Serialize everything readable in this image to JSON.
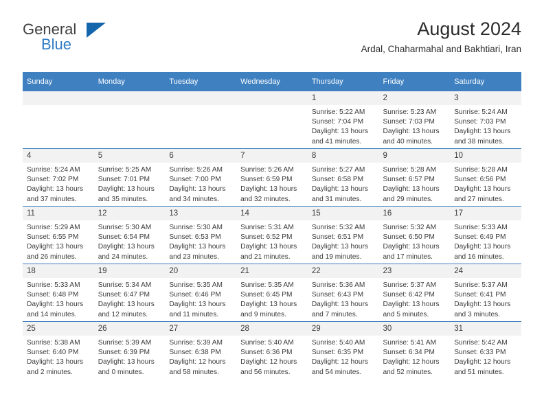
{
  "brand": {
    "name_top": "General",
    "name_bottom": "Blue",
    "logo_color": "#1466ac",
    "blue_text_color": "#2e7bc4"
  },
  "header": {
    "title": "August 2024",
    "subtitle": "Ardal, Chaharmahal and Bakhtiari, Iran",
    "accent_color": "#3f80c1"
  },
  "weekday_headers": [
    "Sunday",
    "Monday",
    "Tuesday",
    "Wednesday",
    "Thursday",
    "Friday",
    "Saturday"
  ],
  "weeks": [
    [
      {
        "day": "",
        "empty": true
      },
      {
        "day": "",
        "empty": true
      },
      {
        "day": "",
        "empty": true
      },
      {
        "day": "",
        "empty": true
      },
      {
        "day": "1",
        "sunrise": "Sunrise: 5:22 AM",
        "sunset": "Sunset: 7:04 PM",
        "daylight1": "Daylight: 13 hours",
        "daylight2": "and 41 minutes."
      },
      {
        "day": "2",
        "sunrise": "Sunrise: 5:23 AM",
        "sunset": "Sunset: 7:03 PM",
        "daylight1": "Daylight: 13 hours",
        "daylight2": "and 40 minutes."
      },
      {
        "day": "3",
        "sunrise": "Sunrise: 5:24 AM",
        "sunset": "Sunset: 7:03 PM",
        "daylight1": "Daylight: 13 hours",
        "daylight2": "and 38 minutes."
      }
    ],
    [
      {
        "day": "4",
        "sunrise": "Sunrise: 5:24 AM",
        "sunset": "Sunset: 7:02 PM",
        "daylight1": "Daylight: 13 hours",
        "daylight2": "and 37 minutes."
      },
      {
        "day": "5",
        "sunrise": "Sunrise: 5:25 AM",
        "sunset": "Sunset: 7:01 PM",
        "daylight1": "Daylight: 13 hours",
        "daylight2": "and 35 minutes."
      },
      {
        "day": "6",
        "sunrise": "Sunrise: 5:26 AM",
        "sunset": "Sunset: 7:00 PM",
        "daylight1": "Daylight: 13 hours",
        "daylight2": "and 34 minutes."
      },
      {
        "day": "7",
        "sunrise": "Sunrise: 5:26 AM",
        "sunset": "Sunset: 6:59 PM",
        "daylight1": "Daylight: 13 hours",
        "daylight2": "and 32 minutes."
      },
      {
        "day": "8",
        "sunrise": "Sunrise: 5:27 AM",
        "sunset": "Sunset: 6:58 PM",
        "daylight1": "Daylight: 13 hours",
        "daylight2": "and 31 minutes."
      },
      {
        "day": "9",
        "sunrise": "Sunrise: 5:28 AM",
        "sunset": "Sunset: 6:57 PM",
        "daylight1": "Daylight: 13 hours",
        "daylight2": "and 29 minutes."
      },
      {
        "day": "10",
        "sunrise": "Sunrise: 5:28 AM",
        "sunset": "Sunset: 6:56 PM",
        "daylight1": "Daylight: 13 hours",
        "daylight2": "and 27 minutes."
      }
    ],
    [
      {
        "day": "11",
        "sunrise": "Sunrise: 5:29 AM",
        "sunset": "Sunset: 6:55 PM",
        "daylight1": "Daylight: 13 hours",
        "daylight2": "and 26 minutes."
      },
      {
        "day": "12",
        "sunrise": "Sunrise: 5:30 AM",
        "sunset": "Sunset: 6:54 PM",
        "daylight1": "Daylight: 13 hours",
        "daylight2": "and 24 minutes."
      },
      {
        "day": "13",
        "sunrise": "Sunrise: 5:30 AM",
        "sunset": "Sunset: 6:53 PM",
        "daylight1": "Daylight: 13 hours",
        "daylight2": "and 23 minutes."
      },
      {
        "day": "14",
        "sunrise": "Sunrise: 5:31 AM",
        "sunset": "Sunset: 6:52 PM",
        "daylight1": "Daylight: 13 hours",
        "daylight2": "and 21 minutes."
      },
      {
        "day": "15",
        "sunrise": "Sunrise: 5:32 AM",
        "sunset": "Sunset: 6:51 PM",
        "daylight1": "Daylight: 13 hours",
        "daylight2": "and 19 minutes."
      },
      {
        "day": "16",
        "sunrise": "Sunrise: 5:32 AM",
        "sunset": "Sunset: 6:50 PM",
        "daylight1": "Daylight: 13 hours",
        "daylight2": "and 17 minutes."
      },
      {
        "day": "17",
        "sunrise": "Sunrise: 5:33 AM",
        "sunset": "Sunset: 6:49 PM",
        "daylight1": "Daylight: 13 hours",
        "daylight2": "and 16 minutes."
      }
    ],
    [
      {
        "day": "18",
        "sunrise": "Sunrise: 5:33 AM",
        "sunset": "Sunset: 6:48 PM",
        "daylight1": "Daylight: 13 hours",
        "daylight2": "and 14 minutes."
      },
      {
        "day": "19",
        "sunrise": "Sunrise: 5:34 AM",
        "sunset": "Sunset: 6:47 PM",
        "daylight1": "Daylight: 13 hours",
        "daylight2": "and 12 minutes."
      },
      {
        "day": "20",
        "sunrise": "Sunrise: 5:35 AM",
        "sunset": "Sunset: 6:46 PM",
        "daylight1": "Daylight: 13 hours",
        "daylight2": "and 11 minutes."
      },
      {
        "day": "21",
        "sunrise": "Sunrise: 5:35 AM",
        "sunset": "Sunset: 6:45 PM",
        "daylight1": "Daylight: 13 hours",
        "daylight2": "and 9 minutes."
      },
      {
        "day": "22",
        "sunrise": "Sunrise: 5:36 AM",
        "sunset": "Sunset: 6:43 PM",
        "daylight1": "Daylight: 13 hours",
        "daylight2": "and 7 minutes."
      },
      {
        "day": "23",
        "sunrise": "Sunrise: 5:37 AM",
        "sunset": "Sunset: 6:42 PM",
        "daylight1": "Daylight: 13 hours",
        "daylight2": "and 5 minutes."
      },
      {
        "day": "24",
        "sunrise": "Sunrise: 5:37 AM",
        "sunset": "Sunset: 6:41 PM",
        "daylight1": "Daylight: 13 hours",
        "daylight2": "and 3 minutes."
      }
    ],
    [
      {
        "day": "25",
        "sunrise": "Sunrise: 5:38 AM",
        "sunset": "Sunset: 6:40 PM",
        "daylight1": "Daylight: 13 hours",
        "daylight2": "and 2 minutes."
      },
      {
        "day": "26",
        "sunrise": "Sunrise: 5:39 AM",
        "sunset": "Sunset: 6:39 PM",
        "daylight1": "Daylight: 13 hours",
        "daylight2": "and 0 minutes."
      },
      {
        "day": "27",
        "sunrise": "Sunrise: 5:39 AM",
        "sunset": "Sunset: 6:38 PM",
        "daylight1": "Daylight: 12 hours",
        "daylight2": "and 58 minutes."
      },
      {
        "day": "28",
        "sunrise": "Sunrise: 5:40 AM",
        "sunset": "Sunset: 6:36 PM",
        "daylight1": "Daylight: 12 hours",
        "daylight2": "and 56 minutes."
      },
      {
        "day": "29",
        "sunrise": "Sunrise: 5:40 AM",
        "sunset": "Sunset: 6:35 PM",
        "daylight1": "Daylight: 12 hours",
        "daylight2": "and 54 minutes."
      },
      {
        "day": "30",
        "sunrise": "Sunrise: 5:41 AM",
        "sunset": "Sunset: 6:34 PM",
        "daylight1": "Daylight: 12 hours",
        "daylight2": "and 52 minutes."
      },
      {
        "day": "31",
        "sunrise": "Sunrise: 5:42 AM",
        "sunset": "Sunset: 6:33 PM",
        "daylight1": "Daylight: 12 hours",
        "daylight2": "and 51 minutes."
      }
    ]
  ]
}
